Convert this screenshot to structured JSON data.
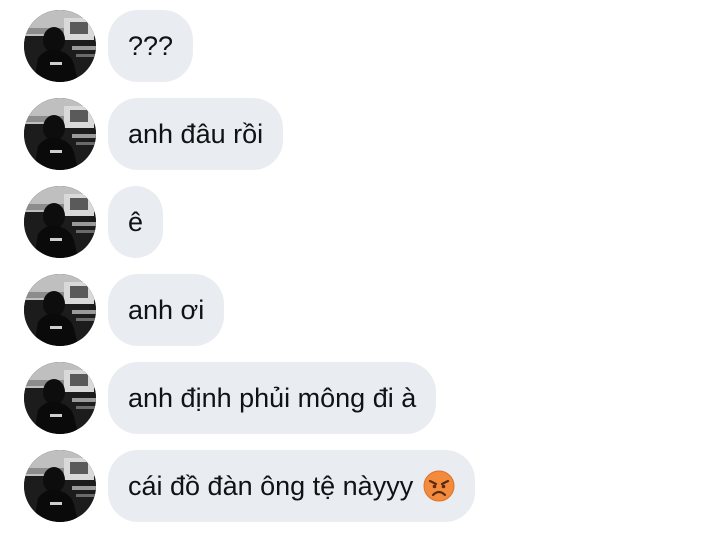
{
  "messages": [
    {
      "text": "???"
    },
    {
      "text": "anh đâu rồi"
    },
    {
      "text": "ê"
    },
    {
      "text": "anh ơi"
    },
    {
      "text": "anh định phủi mông đi à"
    },
    {
      "text": "cái đồ đàn ông tệ nàyyy",
      "emoji": "angry-face-icon"
    }
  ],
  "colors": {
    "bubble_bg": "#e9edf1",
    "text": "#101214",
    "emoji_face": "#f28b3c"
  }
}
